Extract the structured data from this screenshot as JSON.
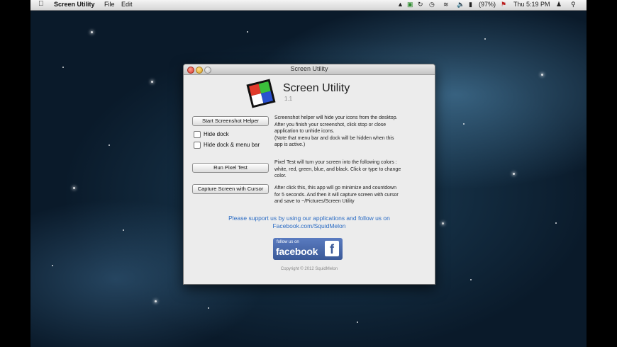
{
  "menubar": {
    "app_name": "Screen Utility",
    "menus": [
      "File",
      "Edit"
    ],
    "battery": "(97%)",
    "clock": "Thu 5:19 PM"
  },
  "window": {
    "title": "Screen Utility",
    "app_name": "Screen Utility",
    "version": "1.1",
    "buttons": {
      "start_helper": "Start Screenshot Helper",
      "pixel_test": "Run Pixel Test",
      "capture_cursor": "Capture Screen with Cursor"
    },
    "checkboxes": {
      "hide_dock": "Hide dock",
      "hide_dock_menubar": "Hide dock & menu bar"
    },
    "descriptions": {
      "helper": [
        "Screenshot helper will hide your icons from the desktop.",
        "After you finish your screenshot, click stop or close",
        "application to unhide icons.",
        "(Note that menu bar and dock will be hidden when this",
        "app is active.)"
      ],
      "pixel": [
        "Pixel Test will turn your screen into the following colors :",
        "white, red, green, blue, and black. Click or type to change",
        "color."
      ],
      "capture": [
        "After click this, this app will go minimize and countdown",
        "for 5 seconds. And then it will capture screen with cursor",
        "and save to ~/Pictures/Screen Utility"
      ]
    },
    "support": [
      "Please support us by using our applications and follow us on",
      "Facebook.com/SquidMelon"
    ],
    "facebook_badge": {
      "follow": "follow us on",
      "word": "facebook",
      "letter": "f"
    },
    "copyright": "Copyright © 2012 SquidMelon"
  },
  "colors": {
    "link": "#2b6cc4",
    "facebook": "#3b5998"
  },
  "icons": [
    "apple-icon",
    "wifi-icon",
    "volume-icon",
    "battery-icon",
    "user-icon",
    "spotlight-icon"
  ]
}
